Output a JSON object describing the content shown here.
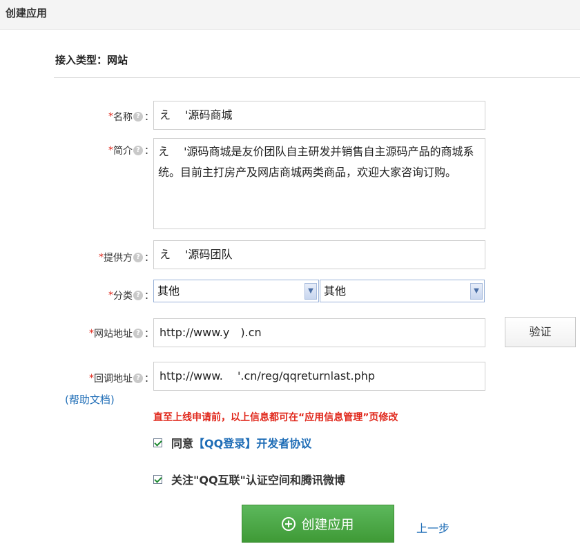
{
  "header": {
    "title": "创建应用"
  },
  "section": {
    "title": "接入类型：网站"
  },
  "form": {
    "required_mark": "*",
    "help_glyph": "?",
    "colon": "：",
    "name": {
      "label": "名称",
      "value": "え　 '源码商城"
    },
    "intro": {
      "label": "简介",
      "value": "え　 '源码商城是友价团队自主研发并销售自主源码产品的商城系统。目前主打房产及网店商城两类商品，欢迎大家咨询订购。"
    },
    "provider": {
      "label": "提供方",
      "value": "え　 '源码团队"
    },
    "category": {
      "label": "分类",
      "primary": "其他",
      "secondary": "其他"
    },
    "website": {
      "label": "网站地址",
      "value": "http://www.y　).cn",
      "verify_label": "验证"
    },
    "callback": {
      "label": "回调地址",
      "value": "http://www.　 '.cn/reg/qqreturnlast.php",
      "help_doc": "(帮助文档)"
    }
  },
  "notice": "直至上线申请前，以上信息都可在“应用信息管理”页修改",
  "agreements": [
    {
      "prefix": "同意",
      "link": "【QQ登录】开发者协议",
      "checked": true
    },
    {
      "prefix": "关注\"QQ互联\"认证空间和腾讯微博",
      "link": "",
      "checked": true
    }
  ],
  "actions": {
    "create_label": "创建应用",
    "prev_label": "上一步"
  },
  "colors": {
    "accent_green": "#4caf50",
    "link_blue": "#1d6cb6",
    "required_red": "#e0271b"
  }
}
